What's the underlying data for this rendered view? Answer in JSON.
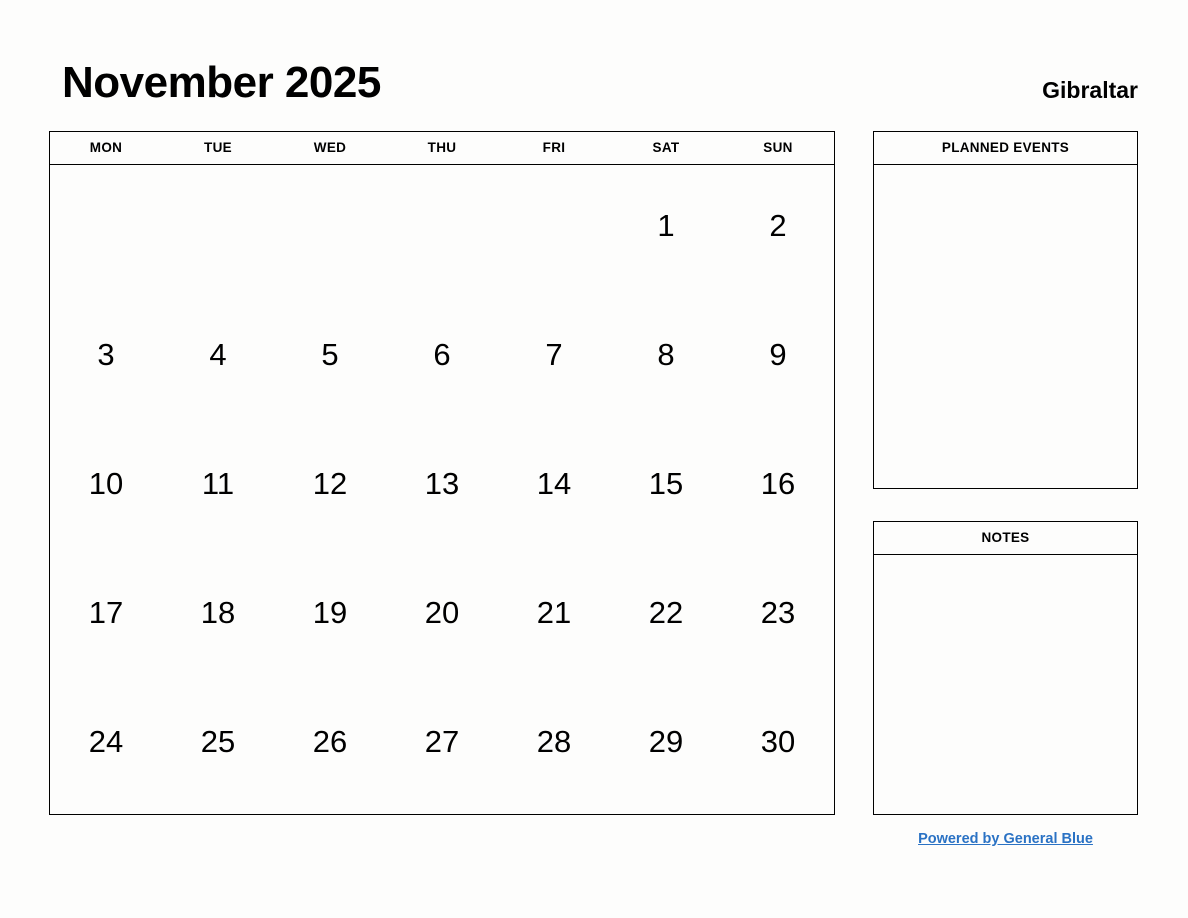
{
  "header": {
    "month_title": "November 2025",
    "region": "Gibraltar"
  },
  "calendar": {
    "weekdays": [
      "MON",
      "TUE",
      "WED",
      "THU",
      "FRI",
      "SAT",
      "SUN"
    ],
    "weeks": [
      [
        "",
        "",
        "",
        "",
        "",
        "1",
        "2"
      ],
      [
        "3",
        "4",
        "5",
        "6",
        "7",
        "8",
        "9"
      ],
      [
        "10",
        "11",
        "12",
        "13",
        "14",
        "15",
        "16"
      ],
      [
        "17",
        "18",
        "19",
        "20",
        "21",
        "22",
        "23"
      ],
      [
        "24",
        "25",
        "26",
        "27",
        "28",
        "29",
        "30"
      ]
    ]
  },
  "panels": {
    "planned_events": {
      "title": "PLANNED EVENTS",
      "content": ""
    },
    "notes": {
      "title": "NOTES",
      "content": ""
    }
  },
  "footer": {
    "link_text": "Powered by General Blue"
  },
  "colors": {
    "link": "#2a72c4",
    "border": "#000000",
    "background": "#fdfdfc",
    "text": "#000000"
  }
}
